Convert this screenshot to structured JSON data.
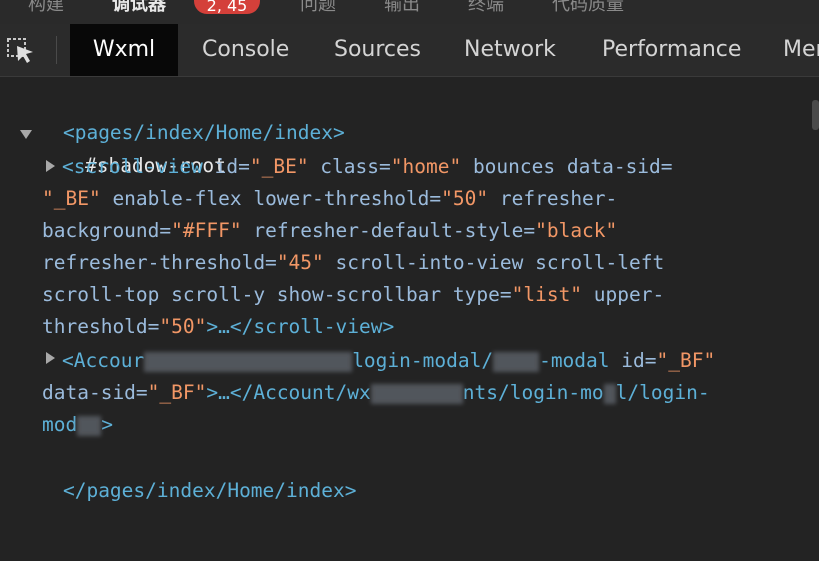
{
  "top_tabs": [
    {
      "label": "构建"
    },
    {
      "label": "调试器"
    },
    {
      "label": "问题"
    },
    {
      "label": "输出"
    },
    {
      "label": "终端"
    },
    {
      "label": "代码质量"
    }
  ],
  "badge": "2, 45",
  "devtools_tabs": [
    "Wxml",
    "Console",
    "Sources",
    "Network",
    "Performance",
    "Mer"
  ],
  "tree": {
    "open_tag": "<pages/index/Home/index>",
    "shadow_root": "#shadow-root",
    "scroll_view": {
      "l1_tag": "<scroll-view",
      "l1_attr1": " id=",
      "l1_val1": "\"_BE\"",
      "l1_attr2": " class=",
      "l1_val2": "\"home\"",
      "l1_attr3": " bounces data-sid=",
      "l2_val1": "\"_BE\"",
      "l2_attr1": " enable-flex lower-threshold=",
      "l2_val2": "\"50\"",
      "l2_attr2": " refresher-",
      "l3_attr1": "background=",
      "l3_val1": "\"#FFF\"",
      "l3_attr2": " refresher-default-style=",
      "l3_val2": "\"black\"",
      "l4_attr1": "refresher-threshold=",
      "l4_val1": "\"45\"",
      "l4_attr2": " scroll-into-view scroll-left",
      "l5_attr1": "scroll-top scroll-y show-scrollbar type=",
      "l5_val1": "\"list\"",
      "l5_attr2": " upper-",
      "l6_attr1": "threshold=",
      "l6_val1": "\"50\"",
      "l6_tag": ">…</scroll-view>"
    },
    "account": {
      "l1_tag_a": "<Accour",
      "l1_tag_b": "login-modal/",
      "l1_tag_c": "-modal",
      "l1_attr1": " id=",
      "l1_val1": "\"_BF\"",
      "l2_attr1": "data-sid=",
      "l2_val1": "\"_BF\"",
      "l2_tag_a": ">…</Account/wx",
      "l2_tag_b": "nts/login-mo",
      "l2_tag_c": "l/login-",
      "l3_tag_a": "mod",
      "l3_tag_b": ">"
    },
    "close_tag": "</pages/index/Home/index>"
  },
  "colors": {
    "background": "#232323",
    "tag": "#5db0d7",
    "attribute": "#9bbbdc",
    "value": "#f29766",
    "active_tab_bg": "#080808",
    "badge": "#d4403a"
  },
  "icons": [
    "inspect-element-icon",
    "expand-caret-icon",
    "collapse-caret-icon"
  ]
}
